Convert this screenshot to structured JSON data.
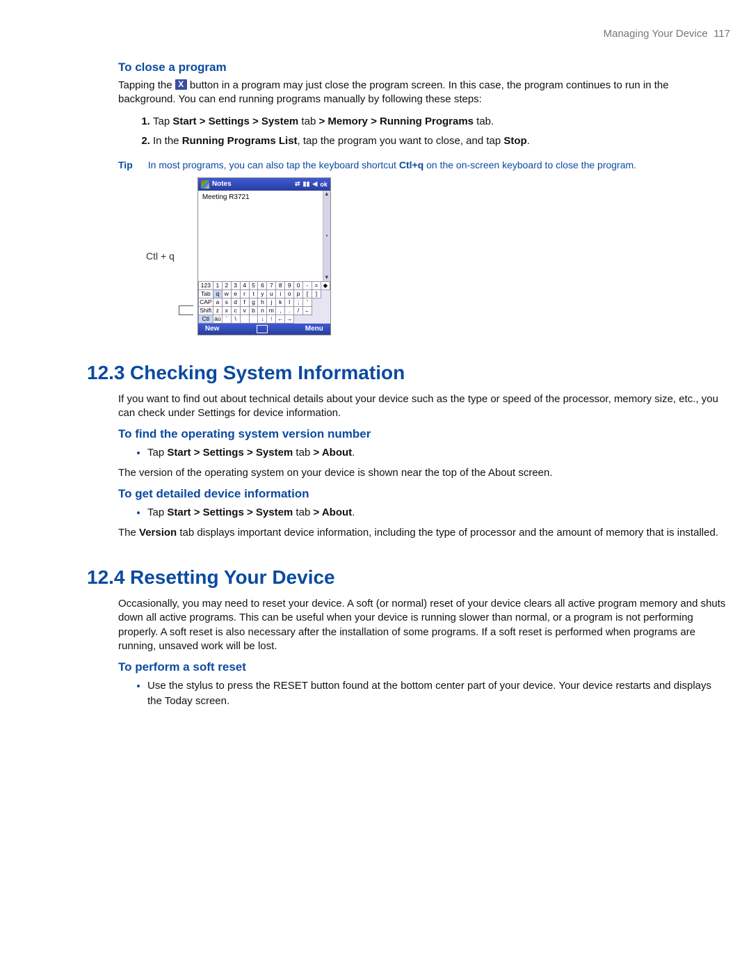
{
  "running_head": {
    "title": "Managing Your Device",
    "page": "117"
  },
  "sec_close": {
    "heading": "To close a program",
    "para_pre": "Tapping the ",
    "x_label": "X",
    "para_post": " button in a program may just close the program screen. In this case, the program continues to run in the background. You can end running programs manually by following these steps:",
    "step1_pre": "Tap ",
    "step1_bold": "Start > Settings > System",
    "step1_mid": " tab ",
    "step1_bold2": "> Memory > Running Programs",
    "step1_post": " tab.",
    "step2_pre": "In the ",
    "step2_bold": "Running Programs List",
    "step2_mid": ", tap the program you want to close, and tap ",
    "step2_bold2": "Stop",
    "step2_post": ".",
    "tip_label": "Tip",
    "tip_pre": "In most programs, you can also tap the keyboard shortcut ",
    "tip_bold": "Ctl+q",
    "tip_post": " on the on-screen keyboard to close the program."
  },
  "device": {
    "callout": "Ctl + q",
    "title": "Notes",
    "ok": "ok",
    "note_text": "Meeting  R3721",
    "bottom_left": "New",
    "bottom_right": "Menu",
    "row1": [
      "123",
      "1",
      "2",
      "3",
      "4",
      "5",
      "6",
      "7",
      "8",
      "9",
      "0",
      "-",
      "=",
      "◆"
    ],
    "row2": [
      "Tab",
      "q",
      "w",
      "e",
      "r",
      "t",
      "y",
      "u",
      "i",
      "o",
      "p",
      "[",
      "]"
    ],
    "row3": [
      "CAP",
      "a",
      "s",
      "d",
      "f",
      "g",
      "h",
      "j",
      "k",
      "l",
      ";",
      "'"
    ],
    "row4": [
      "Shift",
      "z",
      "x",
      "c",
      "v",
      "b",
      "n",
      "m",
      ",",
      ".",
      "/",
      "←"
    ],
    "row5": [
      "Ctl",
      "áü",
      "`",
      "\\",
      " ",
      " ",
      "↓",
      "↑",
      "←",
      "→"
    ]
  },
  "sec_123": {
    "number": "12.3",
    "title": "Checking System Information",
    "intro": "If you want to find out about technical details about your device such as the type or speed of the processor, memory size, etc., you can check under Settings for device information.",
    "sub1_heading": "To find the operating system version number",
    "sub1_bullet_pre": "Tap ",
    "sub1_bullet_bold1": "Start > Settings > System",
    "sub1_bullet_mid": " tab ",
    "sub1_bullet_bold2": "> About",
    "sub1_bullet_post": ".",
    "sub1_para": "The version of the operating system on your device is shown near the top of the About screen.",
    "sub2_heading": "To get detailed device information",
    "sub2_para_pre": "The ",
    "sub2_para_bold": "Version",
    "sub2_para_post": " tab displays important device information, including the type of processor and the amount of memory that is installed."
  },
  "sec_124": {
    "number": "12.4",
    "title": "Resetting Your Device",
    "intro": "Occasionally, you may need to reset your device. A soft (or normal) reset of your device clears all active program memory and shuts down all active programs. This can be useful when your device is running slower than normal, or a program is not performing properly. A soft reset is also necessary after the installation of some programs. If a soft reset is performed when programs are running, unsaved work will be lost.",
    "sub_heading": "To perform a soft reset",
    "bullet": "Use the stylus to press the RESET button found at the bottom center part of your device. Your device restarts and displays the Today screen."
  }
}
